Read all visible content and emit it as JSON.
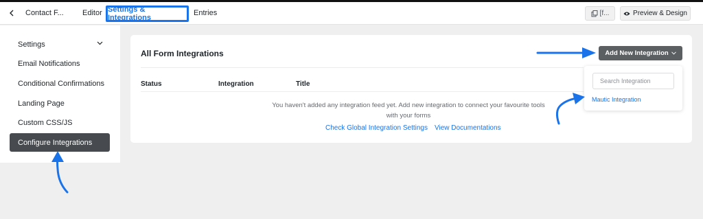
{
  "topbar": {
    "form_name": "Contact F...",
    "tabs": [
      {
        "label": "Editor"
      },
      {
        "label": "Settings & Integrations"
      },
      {
        "label": "Entries"
      }
    ],
    "shortcode_label": "[f...",
    "preview_label": "Preview & Design"
  },
  "sidebar": {
    "items": [
      {
        "label": "Settings"
      },
      {
        "label": "Email Notifications"
      },
      {
        "label": "Conditional Confirmations"
      },
      {
        "label": "Landing Page"
      },
      {
        "label": "Custom CSS/JS"
      },
      {
        "label": "Configure Integrations"
      }
    ]
  },
  "main": {
    "title": "All Form Integrations",
    "add_button_label": "Add New Integration",
    "columns": [
      "Status",
      "Integration",
      "Title"
    ],
    "empty_message": "You haven't added any integration feed yet. Add new integration to connect your favourite tools with your forms",
    "links": {
      "global_settings": "Check Global Integration Settings",
      "documentation": "View Documentations"
    }
  },
  "dropdown": {
    "search_placeholder": "Search Integration",
    "options": [
      {
        "label": "Mautic Integration"
      }
    ]
  },
  "colors": {
    "accent": "#1a73e8",
    "active_sidebar": "#474b4f",
    "primary_button": "#5c5f62"
  }
}
